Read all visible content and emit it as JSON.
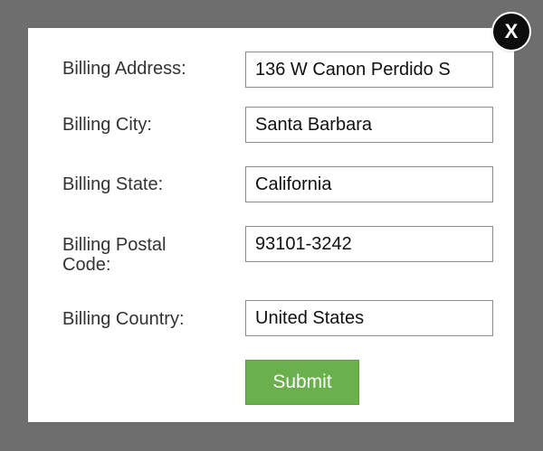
{
  "close_button": {
    "label": "X"
  },
  "form": {
    "fields": [
      {
        "label": "Billing Address:",
        "value": "136 W Canon Perdido S"
      },
      {
        "label": "Billing City:",
        "value": "Santa Barbara"
      },
      {
        "label": "Billing State:",
        "value": "California"
      },
      {
        "label": "Billing Postal Code:",
        "value": "93101-3242"
      },
      {
        "label": "Billing Country:",
        "value": "United States"
      }
    ],
    "submit_label": "Submit"
  },
  "colors": {
    "overlay": "#6e6e6e",
    "modal": "#ffffff",
    "submit": "#6ab04c",
    "close": "#0d0d0d"
  }
}
